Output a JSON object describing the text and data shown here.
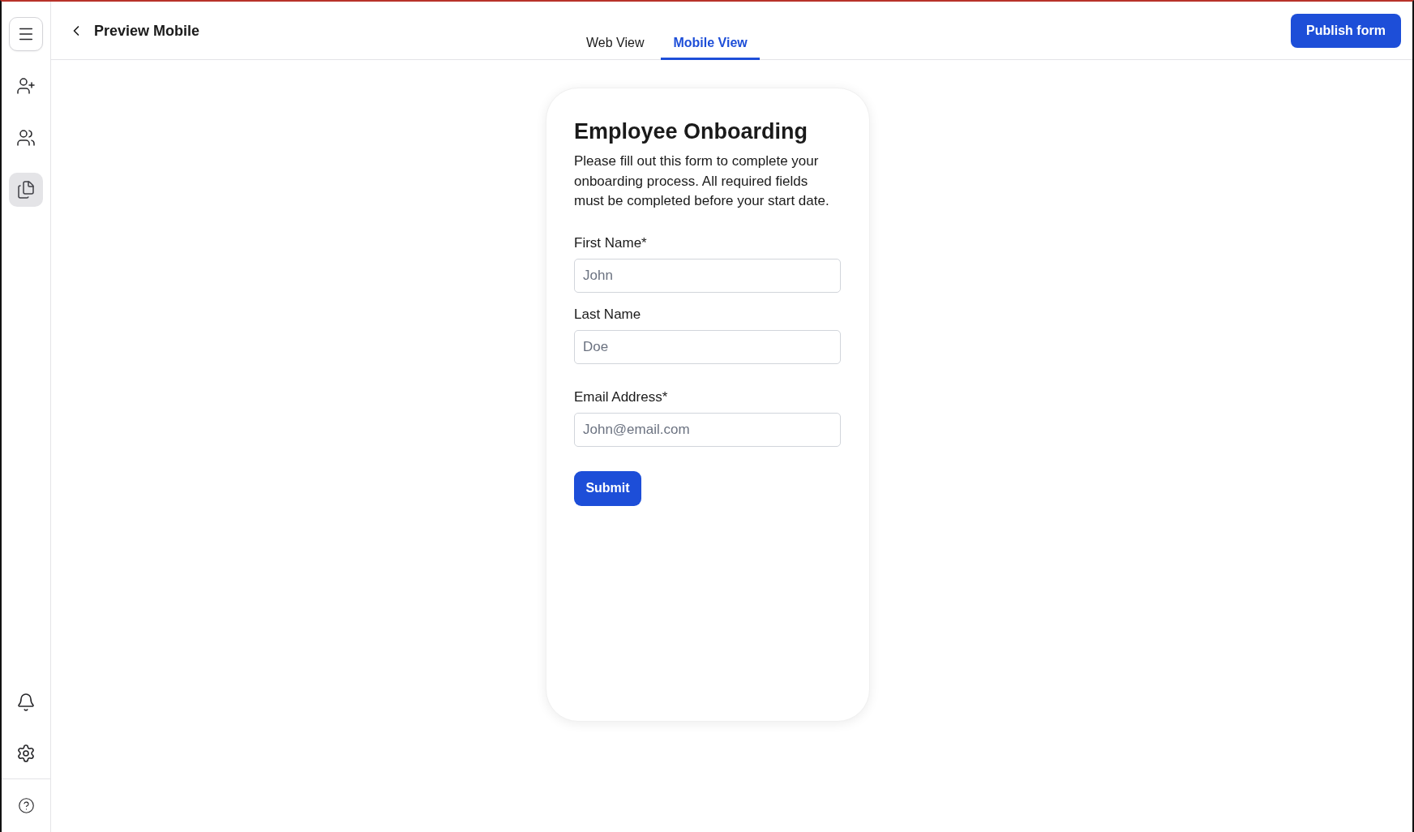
{
  "sidebar": {
    "items": [
      {
        "selected": false
      },
      {
        "selected": false
      },
      {
        "selected": true
      }
    ]
  },
  "header": {
    "title": "Preview Mobile",
    "tabs": [
      {
        "label": "Web View",
        "selected": false
      },
      {
        "label": "Mobile View",
        "selected": true
      }
    ],
    "publish_button": "Publish form"
  },
  "form": {
    "title": "Employee Onboarding",
    "description": "Please fill out this form to complete your onboarding process. All required fields must be completed before your start date.",
    "fields": [
      {
        "label": "First Name*",
        "placeholder": "John"
      },
      {
        "label": "Last Name",
        "placeholder": "Doe"
      },
      {
        "label": "Email Address*",
        "placeholder": "John@email.com"
      }
    ],
    "submit": "Submit"
  }
}
